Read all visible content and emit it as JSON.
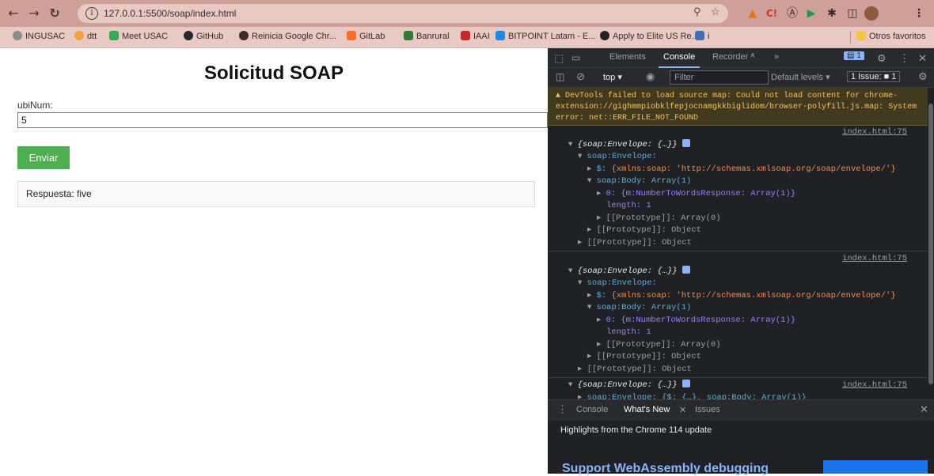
{
  "browser": {
    "url": "127.0.0.1:5500/soap/index.html",
    "bookmarks": [
      "INGUSAC",
      "dtt",
      "Meet USAC",
      "GitHub",
      "Reinicia Google Chr...",
      "GitLab",
      "Banrural",
      "IAAI",
      "BITPOINT Latam - E...",
      "Apply to Elite US Re...",
      "i"
    ],
    "other_bookmarks": "Otros favoritos"
  },
  "page": {
    "title": "Solicitud SOAP",
    "input_label": "ubiNum:",
    "input_value": "5",
    "submit_label": "Enviar",
    "response": "Respuesta: five"
  },
  "devtools": {
    "tabs": [
      "Elements",
      "Console",
      "Recorder ᴬ",
      "»"
    ],
    "active_tab": "Console",
    "issues_badge": "1",
    "context": "top ▾",
    "filter_placeholder": "Filter",
    "levels": "Default levels ▾",
    "issues_count": "1 Issue: ■ 1",
    "warning": "DevTools failed to load source map: Could not load content for chrome-extension://gighmmpiobklfepjocnamgkkbiglidom/browser-polyfill.js.map: System error: net::ERR_FILE_NOT_FOUND",
    "log_source": "index.html:75",
    "log": {
      "summary": "{soap:Envelope: {…}}",
      "envelope": "soap:Envelope:",
      "xmlns_key": "$:",
      "xmlns_val": "{xmlns:soap: 'http://schemas.xmlsoap.org/soap/envelope/'}",
      "body": "soap:Body: Array(1)",
      "item0": "0: {m:NumberToWordsResponse: Array(1)}",
      "length": "length: 1",
      "proto_array": "[[Prototype]]: Array(0)",
      "proto_object": "[[Prototype]]: Object",
      "collapsed": "soap:Envelope: {$: {…}, soap:Body: Array(1)}"
    },
    "drawer_tabs": [
      "Console",
      "What's New",
      "Issues"
    ],
    "drawer_active": "What's New",
    "highlights": "Highlights from the Chrome 114 update",
    "support_heading": "Support WebAssembly debugging"
  }
}
